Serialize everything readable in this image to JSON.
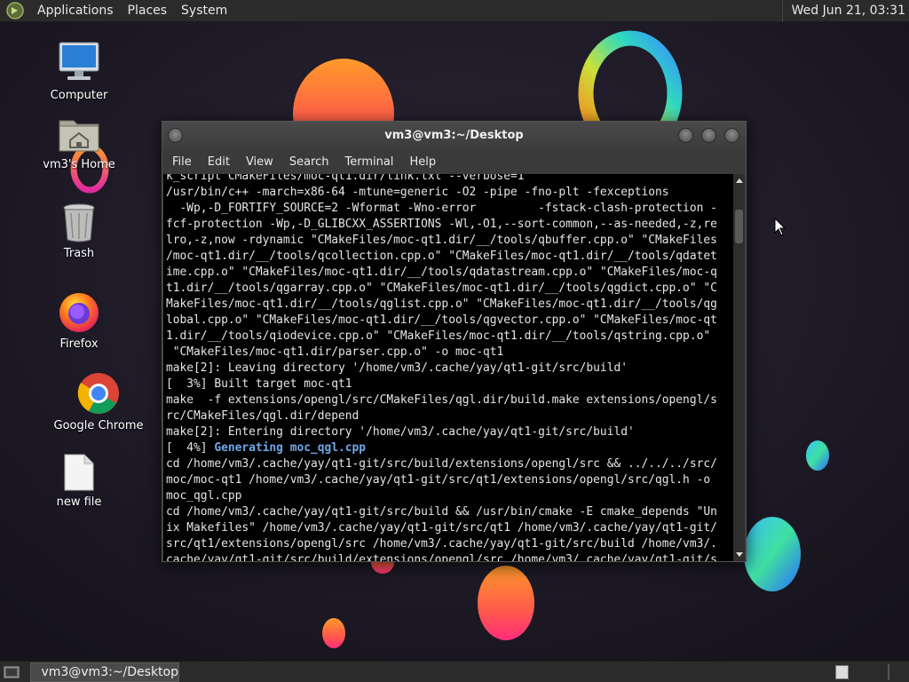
{
  "top_panel": {
    "applications_label": "Applications",
    "places_label": "Places",
    "system_label": "System",
    "clock": "Wed Jun 21, 03:31"
  },
  "desktop_icons": [
    {
      "label": "Computer",
      "icon": "computer-icon"
    },
    {
      "label": "vm3's Home",
      "icon": "home-folder-icon"
    },
    {
      "label": "Trash",
      "icon": "trash-icon"
    },
    {
      "label": "Firefox",
      "icon": "firefox-icon"
    },
    {
      "label": "Google Chrome",
      "icon": "chrome-icon"
    },
    {
      "label": "new file",
      "icon": "file-icon"
    }
  ],
  "terminal": {
    "title": "vm3@vm3:~/Desktop",
    "menu": [
      "File",
      "Edit",
      "View",
      "Search",
      "Terminal",
      "Help"
    ],
    "lines": [
      "k_script CMakeFiles/moc-qt1.dir/link.txt --verbose=1",
      "/usr/bin/c++ -march=x86-64 -mtune=generic -O2 -pipe -fno-plt -fexceptions",
      "  -Wp,-D_FORTIFY_SOURCE=2 -Wformat -Wno-error         -fstack-clash-protection -",
      "fcf-protection -Wp,-D_GLIBCXX_ASSERTIONS -Wl,-O1,--sort-common,--as-needed,-z,re",
      "lro,-z,now -rdynamic \"CMakeFiles/moc-qt1.dir/__/tools/qbuffer.cpp.o\" \"CMakeFiles",
      "/moc-qt1.dir/__/tools/qcollection.cpp.o\" \"CMakeFiles/moc-qt1.dir/__/tools/qdatet",
      "ime.cpp.o\" \"CMakeFiles/moc-qt1.dir/__/tools/qdatastream.cpp.o\" \"CMakeFiles/moc-q",
      "t1.dir/__/tools/qgarray.cpp.o\" \"CMakeFiles/moc-qt1.dir/__/tools/qgdict.cpp.o\" \"C",
      "MakeFiles/moc-qt1.dir/__/tools/qglist.cpp.o\" \"CMakeFiles/moc-qt1.dir/__/tools/qg",
      "lobal.cpp.o\" \"CMakeFiles/moc-qt1.dir/__/tools/qgvector.cpp.o\" \"CMakeFiles/moc-qt",
      "1.dir/__/tools/qiodevice.cpp.o\" \"CMakeFiles/moc-qt1.dir/__/tools/qstring.cpp.o\"",
      " \"CMakeFiles/moc-qt1.dir/parser.cpp.o\" -o moc-qt1",
      "make[2]: Leaving directory '/home/vm3/.cache/yay/qt1-git/src/build'",
      "[  3%] Built target moc-qt1",
      "make  -f extensions/opengl/src/CMakeFiles/qgl.dir/build.make extensions/opengl/s",
      "rc/CMakeFiles/qgl.dir/depend",
      "make[2]: Entering directory '/home/vm3/.cache/yay/qt1-git/src/build'",
      "[  4%] ",
      "cd /home/vm3/.cache/yay/qt1-git/src/build/extensions/opengl/src && ../../../src/",
      "moc/moc-qt1 /home/vm3/.cache/yay/qt1-git/src/qt1/extensions/opengl/src/qgl.h -o",
      "moc_qgl.cpp",
      "cd /home/vm3/.cache/yay/qt1-git/src/build && /usr/bin/cmake -E cmake_depends \"Un",
      "ix Makefiles\" /home/vm3/.cache/yay/qt1-git/src/qt1 /home/vm3/.cache/yay/qt1-git/",
      "src/qt1/extensions/opengl/src /home/vm3/.cache/yay/qt1-git/src/build /home/vm3/.",
      "cache/yay/qt1-git/src/build/extensions/opengl/src /home/vm3/.cache/yay/qt1-git/s"
    ],
    "highlight_text": "Generating moc_qgl.cpp"
  },
  "bottom_panel": {
    "task_label": "vm3@vm3:~/Desktop"
  },
  "colors": {
    "panel_bg": "#2b2b2b",
    "terminal_bg": "#000000",
    "highlight": "#6ea8e8"
  }
}
